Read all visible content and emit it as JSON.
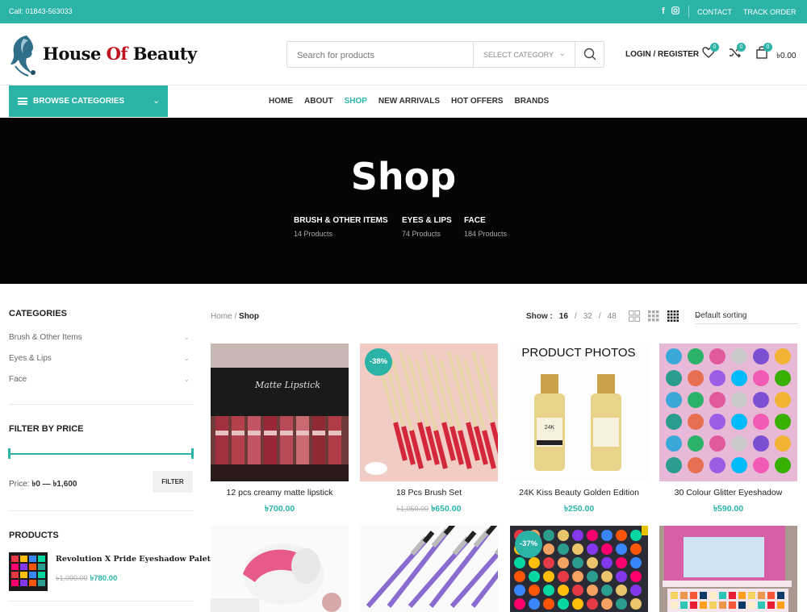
{
  "topbar": {
    "call": "Call: 01843-563033",
    "links": [
      "CONTACT",
      "TRACK ORDER"
    ],
    "social_icons": [
      "facebook-icon",
      "instagram-icon"
    ]
  },
  "header": {
    "logo_part1": "House ",
    "logo_part2": "Of",
    "logo_part3": " Beauty",
    "search_placeholder": "Search for products",
    "category_select": "SELECT CATEGORY",
    "login": "LOGIN / REGISTER",
    "wishlist_count": "0",
    "compare_count": "0",
    "cart_count": "0",
    "cart_total": "৳0.00"
  },
  "nav": {
    "browse_label": "BROWSE CATEGORIES",
    "items": [
      "HOME",
      "ABOUT",
      "SHOP",
      "NEW ARRIVALS",
      "HOT OFFERS",
      "BRANDS"
    ],
    "active": "SHOP"
  },
  "hero": {
    "title": "Shop",
    "categories": [
      {
        "name": "BRUSH & OTHER ITEMS",
        "count": "14 Products"
      },
      {
        "name": "EYES & LIPS",
        "count": "74 Products"
      },
      {
        "name": "FACE",
        "count": "184 Products"
      }
    ]
  },
  "sidebar": {
    "categories_title": "CATEGORIES",
    "categories": [
      "Brush & Other Items",
      "Eyes & Lips",
      "Face"
    ],
    "price_title": "FILTER BY PRICE",
    "price_prefix": "Price:",
    "price_range": "৳0 — ৳1,600",
    "filter_button": "FILTER",
    "products_title": "PRODUCTS",
    "product": {
      "name": "Revolution X Pride Eyeshadow Palette",
      "old_price": "৳1,090.00",
      "price": "৳780.00"
    }
  },
  "toolbar": {
    "breadcrumb_home": "Home",
    "breadcrumb_sep": "/",
    "breadcrumb_current": "Shop",
    "show_label": "Show :",
    "show_options": [
      "16",
      "32",
      "48"
    ],
    "show_current": "16",
    "sort": "Default sorting"
  },
  "products": [
    {
      "name": "12 pcs creamy matte lipstick",
      "old_price": "",
      "price": "৳700.00",
      "sale": ""
    },
    {
      "name": "18 Pcs Brush Set",
      "old_price": "৳1,050.00",
      "price": "৳650.00",
      "sale": "-38%"
    },
    {
      "name": "24K Kiss Beauty Golden Edition",
      "old_price": "",
      "price": "৳250.00",
      "sale": ""
    },
    {
      "name": "30 Colour Glitter Eyeshadow",
      "old_price": "",
      "price": "৳590.00",
      "sale": ""
    },
    {
      "name": "",
      "old_price": "",
      "price": "",
      "sale": ""
    },
    {
      "name": "",
      "old_price": "",
      "price": "",
      "sale": ""
    },
    {
      "name": "",
      "old_price": "",
      "price": "",
      "sale": "-37%"
    },
    {
      "name": "",
      "old_price": "",
      "price": "",
      "sale": ""
    }
  ],
  "image_text": {
    "lipstick_box": "Matte Lipstick",
    "product_photos": "PRODUCT PHOTOS",
    "bottle_label": "24K"
  },
  "colors": {
    "accent": "#2bb3a8",
    "hero_bg": "#050505",
    "logo_red": "#c0121f"
  }
}
